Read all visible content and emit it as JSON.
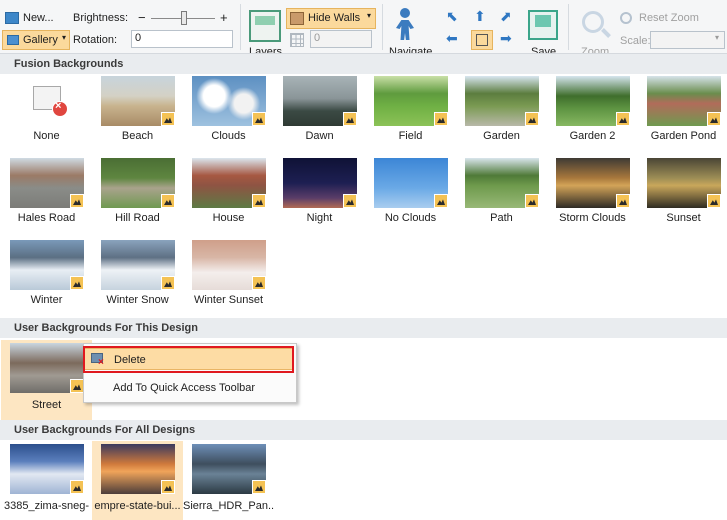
{
  "ribbon": {
    "new_label": "New...",
    "gallery_label": "Gallery",
    "brightness_label": "Brightness:",
    "brightness_minus": "−",
    "brightness_plus": "+",
    "rotation_label": "Rotation:",
    "rotation_value": "0",
    "layers_label": "Layers",
    "hide_walls_label": "Hide Walls",
    "wall_value": "0",
    "navigate_label": "Navigate",
    "save_label": "Save",
    "zoom_label": "Zoom",
    "reset_zoom_label": "Reset Zoom",
    "scale_label": "Scale:",
    "brightness_level": 0.6
  },
  "sections": {
    "fusion": "Fusion Backgrounds",
    "user_design": "User Backgrounds For This Design",
    "user_all": "User Backgrounds For All Designs"
  },
  "fusion_tiles": [
    {
      "label": "None"
    },
    {
      "label": "Beach"
    },
    {
      "label": "Clouds"
    },
    {
      "label": "Dawn"
    },
    {
      "label": "Field"
    },
    {
      "label": "Garden"
    },
    {
      "label": "Garden 2"
    },
    {
      "label": "Garden Pond"
    },
    {
      "label": "Hales Road"
    },
    {
      "label": "Hill Road"
    },
    {
      "label": "House"
    },
    {
      "label": "Night"
    },
    {
      "label": "No Clouds"
    },
    {
      "label": "Path"
    },
    {
      "label": "Storm Clouds"
    },
    {
      "label": "Sunset"
    },
    {
      "label": "Winter"
    },
    {
      "label": "Winter Snow"
    },
    {
      "label": "Winter Sunset"
    }
  ],
  "design_tiles": [
    {
      "label": "Street"
    }
  ],
  "all_tiles": [
    {
      "label": "3385_zima-sneg-"
    },
    {
      "label": "empre-state-bui..."
    },
    {
      "label": "Sierra_HDR_Pan..."
    }
  ],
  "context_menu": {
    "delete": "Delete",
    "add_qat": "Add To Quick Access Toolbar"
  },
  "colors": {
    "accent": "#fbd99c",
    "highlight_border": "#e0191f",
    "badge": "#f4c254"
  }
}
